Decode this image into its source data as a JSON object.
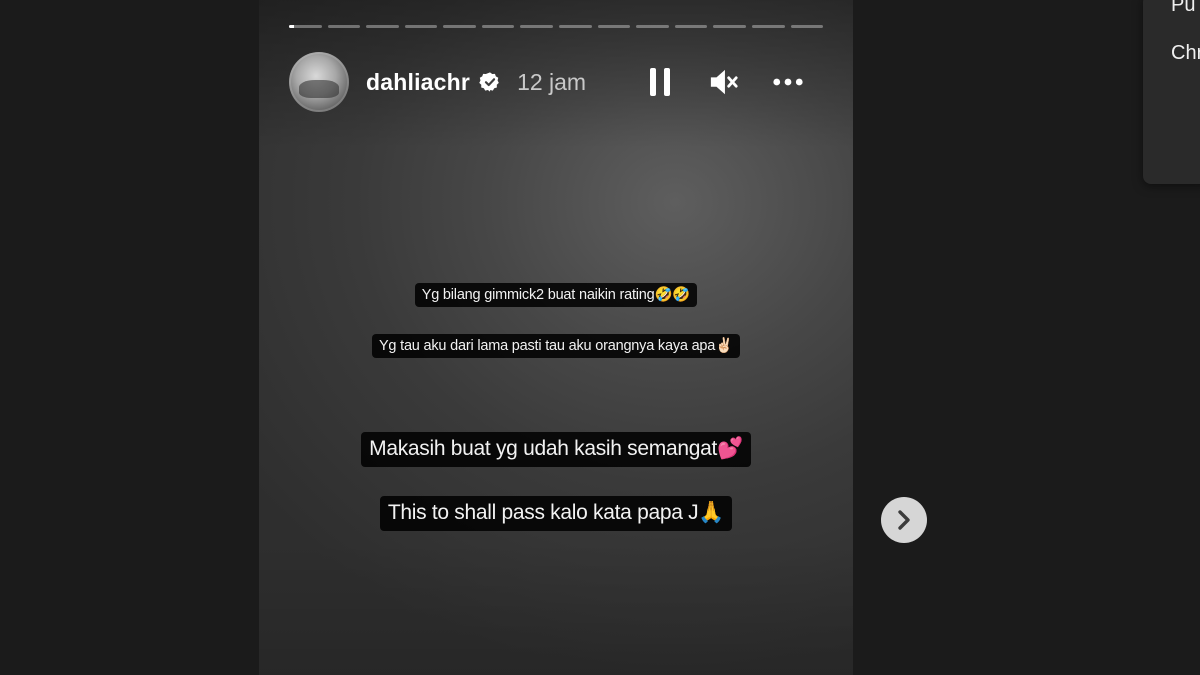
{
  "story": {
    "progress": {
      "segment_count": 14,
      "active_index": 0,
      "active_fill": 0.15
    },
    "header": {
      "username": "dahliachr",
      "time": "12 jam",
      "verified_icon": "verified-badge-icon",
      "pause_icon": "pause-icon",
      "mute_icon": "mute-icon",
      "more_icon": "more-options-icon"
    },
    "captions": [
      "Yg bilang gimmick2 buat naikin rating🤣🤣",
      "Yg tau aku dari lama pasti tau aku orangnya kaya apa✌🏻",
      "Makasih buat yg udah kasih semangat💕",
      "This to shall pass kalo kata papa J🙏"
    ]
  },
  "navigation": {
    "next_icon": "chevron-right-icon"
  },
  "popup_menu": {
    "items": [
      "Pu",
      "Chr"
    ]
  },
  "colors": {
    "page_background": "#1b1b1b",
    "caption_background": "#000000",
    "text": "#ffffff"
  }
}
